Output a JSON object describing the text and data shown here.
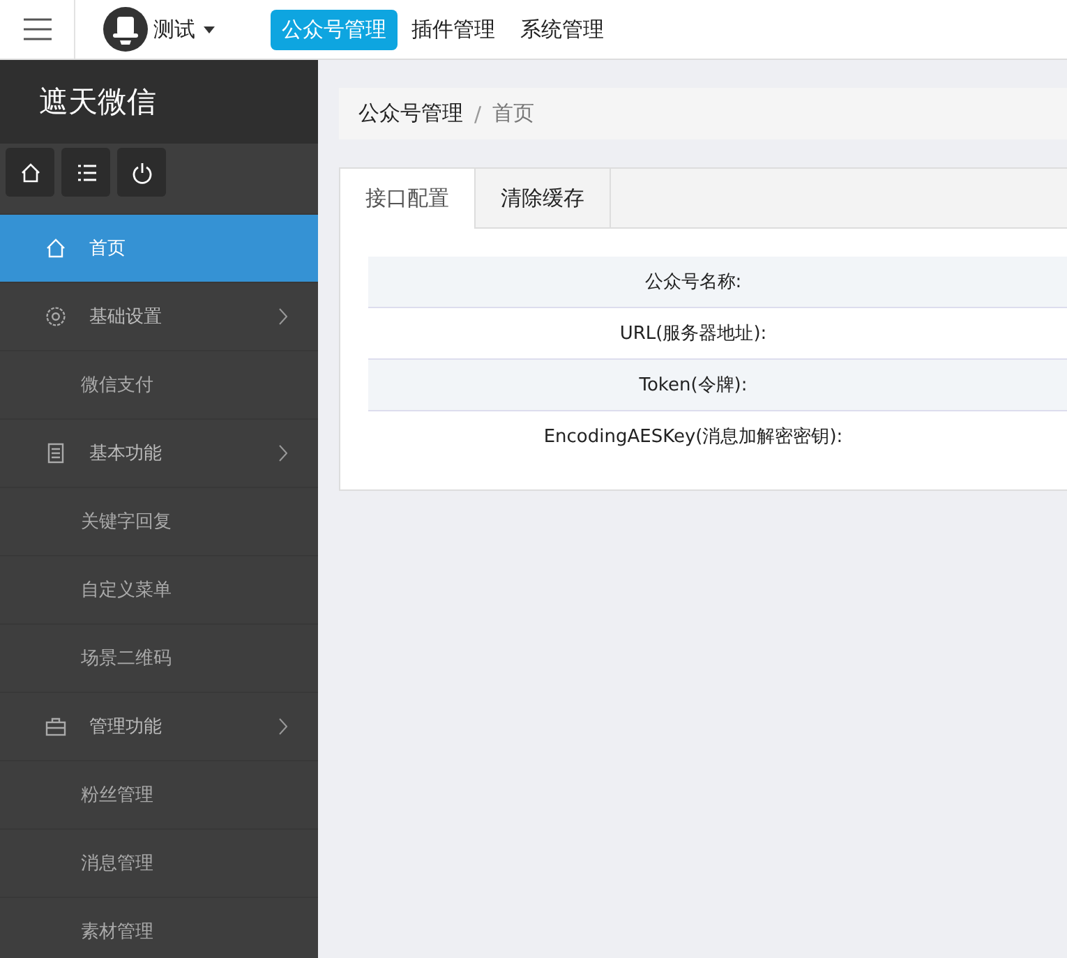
{
  "topbar": {
    "user": "测试",
    "nav": [
      {
        "label": "公众号管理",
        "selected": true
      },
      {
        "label": "插件管理",
        "selected": false
      },
      {
        "label": "系统管理",
        "selected": false
      }
    ]
  },
  "sidebar": {
    "logo": "遮天微信",
    "tools": [
      {
        "kind": "home"
      },
      {
        "kind": "list"
      },
      {
        "kind": "power"
      }
    ],
    "items": [
      {
        "label": "首页",
        "selected": true
      },
      {
        "label": "基础设置",
        "selected": false,
        "children": [
          {
            "label": "微信支付",
            "selected": false
          }
        ]
      },
      {
        "label": "基本功能",
        "selected": false,
        "children": [
          {
            "label": "关键字回复",
            "selected": false
          },
          {
            "label": "自定义菜单",
            "selected": false
          },
          {
            "label": "场景二维码",
            "selected": false
          }
        ]
      },
      {
        "label": "管理功能",
        "selected": false,
        "children": [
          {
            "label": "粉丝管理",
            "selected": false
          },
          {
            "label": "消息管理",
            "selected": false
          },
          {
            "label": "素材管理",
            "selected": false
          }
        ]
      }
    ]
  },
  "breadcrumb": [
    "公众号管理",
    "首页"
  ],
  "breadcrumb_separator": "/",
  "tabs": [
    {
      "label": "接口配置",
      "selected": true
    },
    {
      "label": "清除缓存",
      "selected": false
    }
  ],
  "table": {
    "rows": [
      "公众号名称:",
      "URL(服务器地址):",
      "Token(令牌):",
      "EncodingAESKey(消息加解密密钥):"
    ]
  }
}
